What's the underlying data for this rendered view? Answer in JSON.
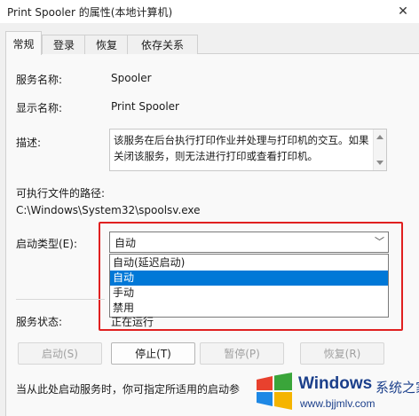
{
  "window": {
    "title": "Print Spooler 的属性(本地计算机)",
    "close": "✕"
  },
  "tabs": [
    "常规",
    "登录",
    "恢复",
    "依存关系"
  ],
  "fields": {
    "service_name_label": "服务名称:",
    "service_name_value": "Spooler",
    "display_name_label": "显示名称:",
    "display_name_value": "Print Spooler",
    "description_label": "描述:",
    "description_value": "该服务在后台执行打印作业并处理与打印机的交互。如果关闭该服务，则无法进行打印或查看打印机。",
    "exe_path_label": "可执行文件的路径:",
    "exe_path_value": "C:\\Windows\\System32\\spoolsv.exe",
    "startup_type_label": "启动类型(E):",
    "startup_type_value": "自动",
    "service_status_label": "服务状态:",
    "service_status_value": "正在运行"
  },
  "startup_options": [
    "自动(延迟启动)",
    "自动",
    "手动",
    "禁用"
  ],
  "startup_selected_index": 1,
  "buttons": {
    "start": "启动(S)",
    "stop": "停止(T)",
    "pause": "暂停(P)",
    "resume": "恢复(R)"
  },
  "hint_text": "当从此处启动服务时，你可指定所适用的启动参",
  "watermark": {
    "name": "Windows",
    "cn": "系统之家",
    "url": "www.bjjmlv.com"
  },
  "colors": {
    "selected": "#0078d7",
    "highlight": "#e02020",
    "watermark": "#1b3f8b"
  }
}
